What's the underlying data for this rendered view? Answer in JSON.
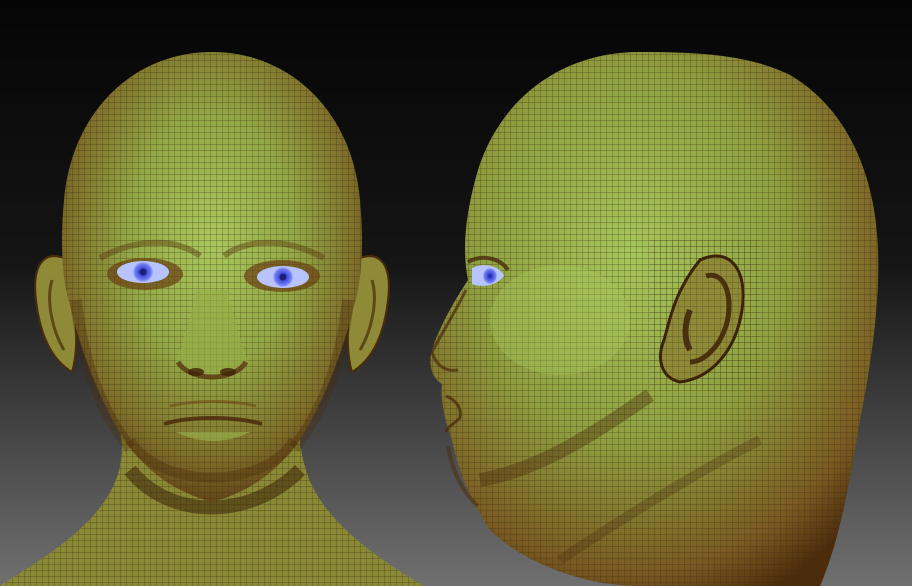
{
  "image": {
    "subject": "",
    "views": [
      {
        "name": "front-view"
      },
      {
        "name": "side-view"
      }
    ]
  },
  "colors": {
    "background_top": "#0a0a0a",
    "background_bottom": "#6e6e6e",
    "skin_light": "#a3c25a",
    "skin_mid": "#8a9a38",
    "skin_dark": "#7a4a1c",
    "skin_shadow": "#3d2208",
    "wire": "#3a2a12",
    "iris": "#5a6cf0",
    "pupil": "#1c1f7a",
    "eye_white": "#b8c4ff"
  }
}
